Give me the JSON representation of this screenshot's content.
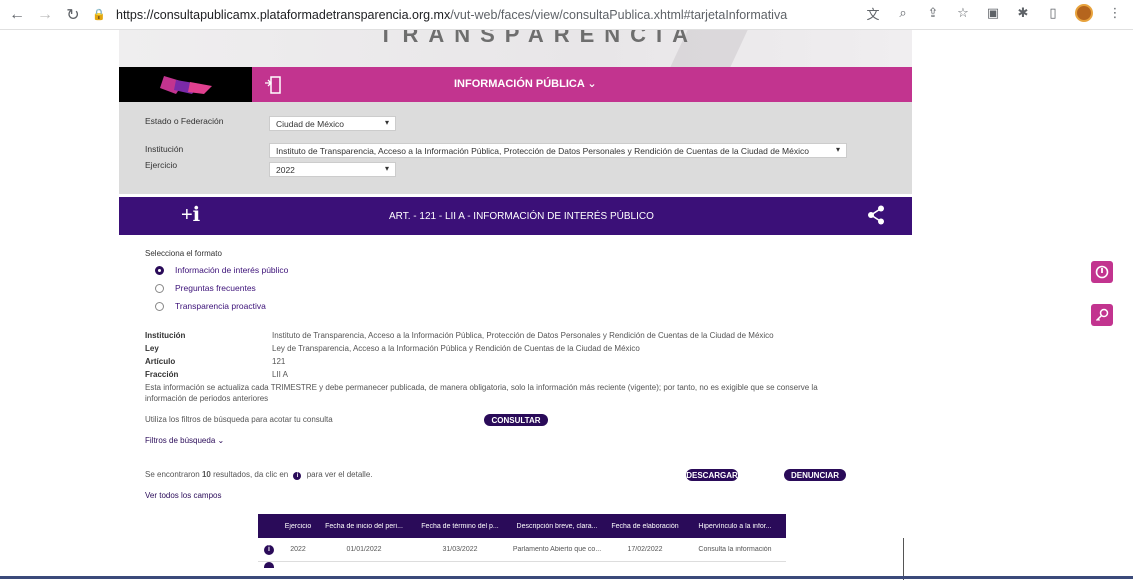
{
  "browser": {
    "url_host": "https://consultapublicamx.plataformadetransparencia.org.mx",
    "url_path": "/vut-web/faces/view/consultaPublica.xhtml#tarjetaInformativa",
    "back_icon": "arrow-left-icon",
    "forward_icon": "arrow-right-icon",
    "reload_icon": "reload-icon"
  },
  "banner": {
    "text": "TRANSPARENCIA"
  },
  "topbar": {
    "menu_label": "INFORMACIÓN PÚBLICA ⌄"
  },
  "filters": {
    "estado_label": "Estado o Federación",
    "estado_value": "Ciudad de México",
    "institucion_label": "Institución",
    "institucion_value": "Instituto de Transparencia, Acceso a la Información Pública, Protección de Datos Personales y Rendición de Cuentas de la Ciudad de México",
    "ejercicio_label": "Ejercicio",
    "ejercicio_value": "2022"
  },
  "header": {
    "title": "ART. - 121 - LII A - INFORMACIÓN DE INTERÉS PÚBLICO"
  },
  "format": {
    "label": "Selecciona el formato",
    "options": [
      {
        "label": "Información de interés público",
        "selected": true
      },
      {
        "label": "Preguntas frecuentes",
        "selected": false
      },
      {
        "label": "Transparencia proactiva",
        "selected": false
      }
    ]
  },
  "meta": {
    "institucion_key": "Institución",
    "institucion_val": "Instituto de Transparencia, Acceso a la Información Pública, Protección de Datos Personales y Rendición de Cuentas de la Ciudad de México",
    "ley_key": "Ley",
    "ley_val": "Ley de Transparencia, Acceso a la Información Pública y Rendición de Cuentas de la Ciudad de México",
    "articulo_key": "Artículo",
    "articulo_val": "121",
    "fraccion_key": "Fracción",
    "fraccion_val": "LII A",
    "note_line1": "Esta información se actualiza cada TRIMESTRE y debe permanecer publicada, de manera obligatoria, solo la información más reciente (vigente); por tanto, no es exigible que se conserve la",
    "note_line2": "información de periodos anteriores"
  },
  "search": {
    "hint": "Utiliza los filtros de búsqueda para acotar tu consulta",
    "consultar": "CONSULTAR",
    "filters_link": "Filtros de búsqueda ⌄"
  },
  "results": {
    "prefix": "Se encontraron ",
    "count": "10",
    "suffix": " resultados, da clic en",
    "suffix2": "para ver el detalle.",
    "descargar": "DESCARGAR",
    "denunciar": "DENUNCIAR",
    "ver_todos": "Ver todos los campos"
  },
  "table": {
    "headers": [
      "",
      "Ejercicio",
      "Fecha de inicio del peri...",
      "Fecha de término del p...",
      "Descripción breve, clara...",
      "Fecha de elaboración",
      "Hipervínculo a la infor..."
    ],
    "rows": [
      [
        "",
        "2022",
        "01/01/2022",
        "31/03/2022",
        "Parlamento Abierto que co...",
        "17/02/2022",
        "Consulta la información"
      ]
    ]
  }
}
